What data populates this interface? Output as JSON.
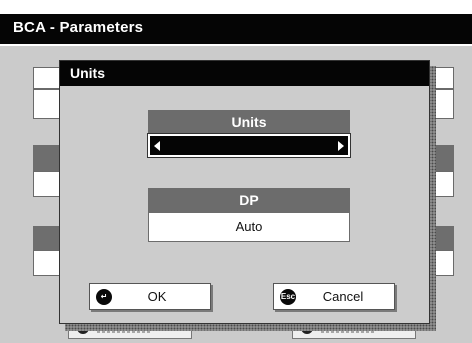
{
  "window": {
    "title": "BCA - Parameters"
  },
  "dialog": {
    "title": "Units",
    "units_field": {
      "label": "Units",
      "value": ""
    },
    "dp_field": {
      "label": "DP",
      "value": "Auto"
    },
    "ok_button": {
      "label": "OK",
      "icon": "enter-icon"
    },
    "cancel_button": {
      "label": "Cancel",
      "icon": "esc-icon",
      "icon_text": "Esc"
    }
  },
  "colors": {
    "titlebar": "#050505",
    "dialog_bg": "#cccccc",
    "field_header": "#6c6c6c"
  }
}
